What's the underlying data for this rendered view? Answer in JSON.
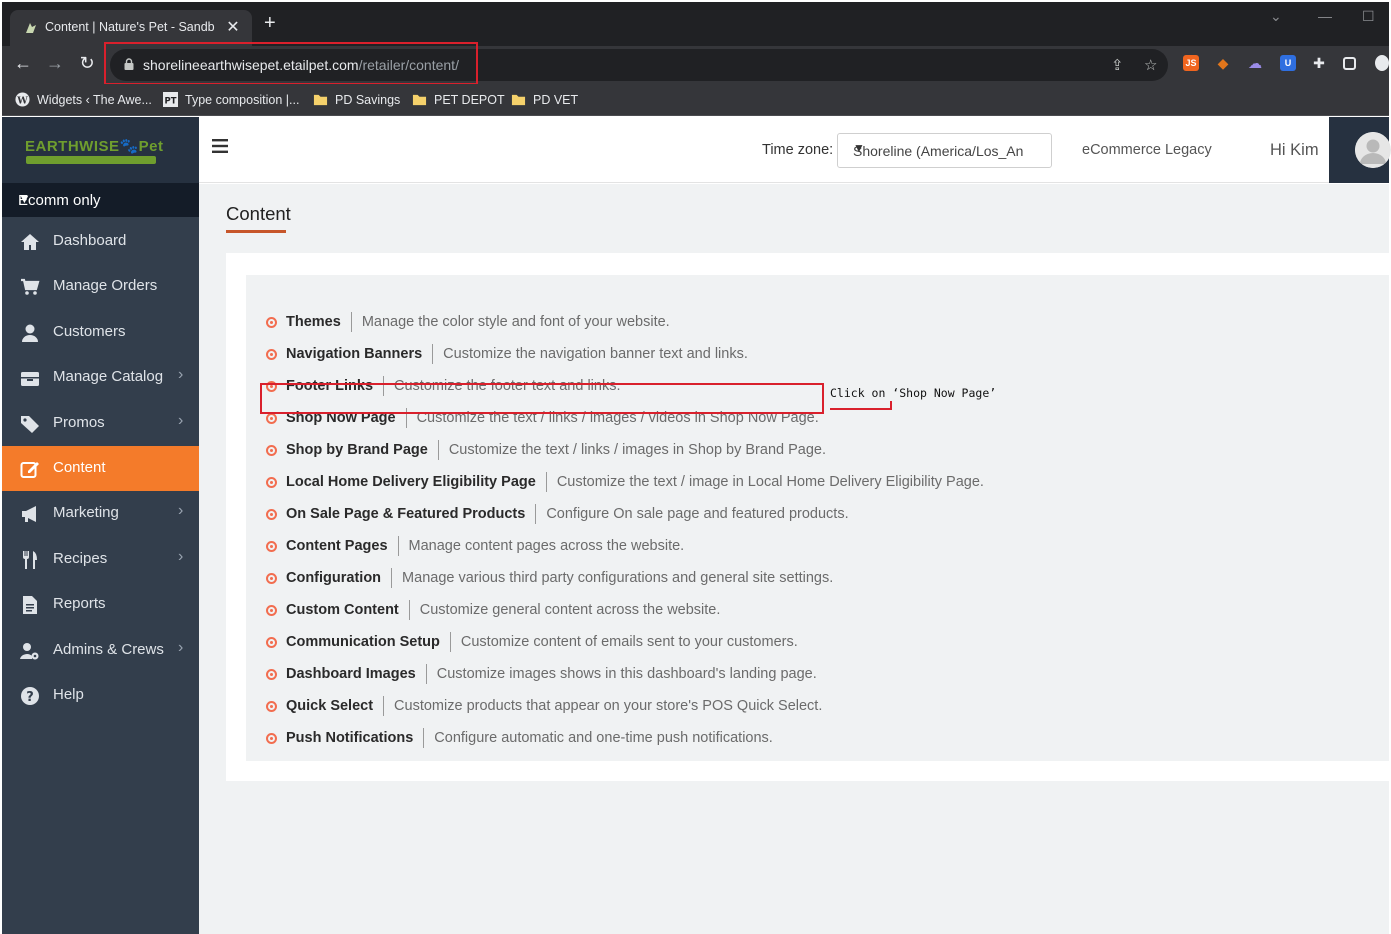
{
  "browser": {
    "tab_title": "Content | Nature's Pet - Sandbo:",
    "tab_close": "✕",
    "new_tab": "+",
    "url_host": "shorelineearthwisepet.etailpet.com",
    "url_path": "/retailer/content/",
    "bookmarks": [
      {
        "label": "Widgets ‹ The Awe...",
        "icon": "wordpress-icon"
      },
      {
        "label": "Type composition |...",
        "icon": "pt-icon"
      },
      {
        "label": "PD Savings",
        "icon": "folder-icon"
      },
      {
        "label": "PET DEPOT",
        "icon": "folder-icon"
      },
      {
        "label": "PD VET",
        "icon": "folder-icon"
      }
    ]
  },
  "sidebar": {
    "store_selector": "Ecomm only",
    "items": [
      {
        "label": "Dashboard",
        "icon": "home-icon",
        "has_submenu": false
      },
      {
        "label": "Manage Orders",
        "icon": "cart-icon",
        "has_submenu": false
      },
      {
        "label": "Customers",
        "icon": "user-icon",
        "has_submenu": false
      },
      {
        "label": "Manage Catalog",
        "icon": "box-icon",
        "has_submenu": true
      },
      {
        "label": "Promos",
        "icon": "tag-icon",
        "has_submenu": true
      },
      {
        "label": "Content",
        "icon": "edit-icon",
        "has_submenu": false,
        "active": true
      },
      {
        "label": "Marketing",
        "icon": "megaphone-icon",
        "has_submenu": true
      },
      {
        "label": "Recipes",
        "icon": "utensils-icon",
        "has_submenu": true
      },
      {
        "label": "Reports",
        "icon": "document-icon",
        "has_submenu": false
      },
      {
        "label": "Admins & Crews",
        "icon": "user-gear-icon",
        "has_submenu": true
      },
      {
        "label": "Help",
        "icon": "help-icon",
        "has_submenu": false
      }
    ]
  },
  "header": {
    "timezone_label": "Time zone:",
    "timezone_value": "Shoreline (America/Los_Angeles)",
    "legacy_link": "eCommerce Legacy",
    "greeting": "Hi Kim"
  },
  "main": {
    "title": "Content",
    "items": [
      {
        "name": "Themes",
        "desc": "Manage the color style and font of your website."
      },
      {
        "name": "Navigation Banners",
        "desc": "Customize the navigation banner text and links."
      },
      {
        "name": "Footer Links",
        "desc": "Customize the footer text and links."
      },
      {
        "name": "Shop Now Page",
        "desc": "Customize the text / links / images / videos in Shop Now Page."
      },
      {
        "name": "Shop by Brand Page",
        "desc": "Customize the text / links / images in Shop by Brand Page."
      },
      {
        "name": "Local Home Delivery Eligibility Page",
        "desc": "Customize the text / image in Local Home Delivery Eligibility Page."
      },
      {
        "name": "On Sale Page & Featured Products",
        "desc": "Configure On sale page and featured products."
      },
      {
        "name": "Content Pages",
        "desc": "Manage content pages across the website."
      },
      {
        "name": "Configuration",
        "desc": "Manage various third party configurations and general site settings."
      },
      {
        "name": "Custom Content",
        "desc": "Customize general content across the website."
      },
      {
        "name": "Communication Setup",
        "desc": "Customize content of emails sent to your customers."
      },
      {
        "name": "Dashboard Images",
        "desc": "Customize images shows in this dashboard's landing page."
      },
      {
        "name": "Quick Select",
        "desc": "Customize products that appear on your store's POS Quick Select."
      },
      {
        "name": "Push Notifications",
        "desc": "Configure automatic and one-time push notifications."
      }
    ]
  },
  "annotation": {
    "text": "Click on ‘Shop Now Page’",
    "color": "#d9202c"
  },
  "colors": {
    "accent": "#f47b2a",
    "sidebar_bg": "#333e4c",
    "bullet": "#f26d4f"
  }
}
